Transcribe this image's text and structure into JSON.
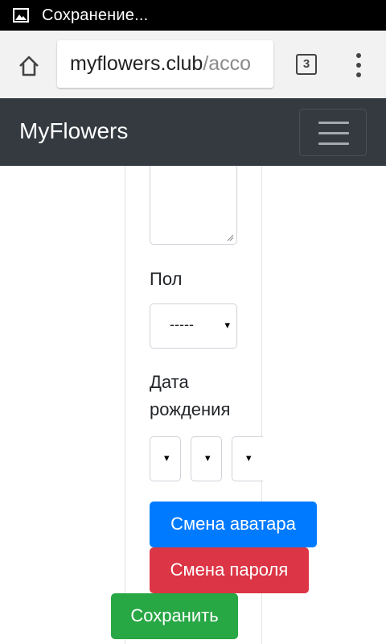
{
  "status_bar": {
    "icon": "image-icon",
    "text": "Сохранение..."
  },
  "browser": {
    "url_domain": "myflowers.club",
    "url_path": "/acco",
    "tab_count": "3",
    "home_icon": "home-icon",
    "menu_icon": "more-vert-icon"
  },
  "navbar": {
    "brand": "MyFlowers",
    "toggler_icon": "hamburger-icon"
  },
  "form": {
    "gender_label": "Пол",
    "gender_value": "-----",
    "birthdate_label": "Дата рождения",
    "caret": "▾",
    "change_avatar_label": "Смена аватара",
    "change_password_label": "Смена пароля",
    "save_label": "Сохранить"
  },
  "colors": {
    "navbar_bg": "#343a40",
    "primary": "#007bff",
    "danger": "#dc3545",
    "success": "#28a745"
  }
}
